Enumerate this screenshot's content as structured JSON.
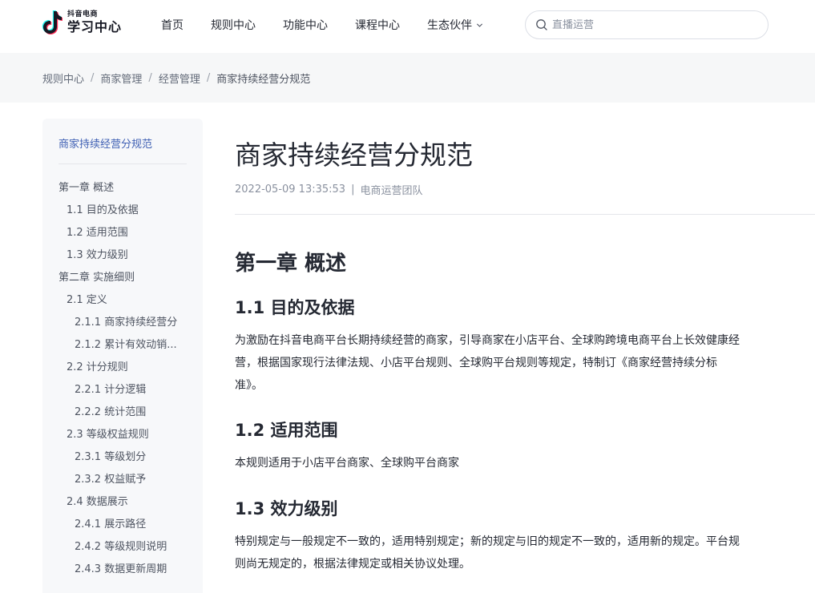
{
  "header": {
    "logo": {
      "sub": "抖音电商",
      "main": "学习中心"
    },
    "nav": [
      {
        "label": "首页"
      },
      {
        "label": "规则中心"
      },
      {
        "label": "功能中心"
      },
      {
        "label": "课程中心"
      },
      {
        "label": "生态伙伴",
        "icon": "chevron-down-icon"
      }
    ],
    "search": {
      "placeholder": "直播运营",
      "value": ""
    }
  },
  "breadcrumb": [
    "规则中心",
    "商家管理",
    "经营管理",
    "商家持续经营分规范"
  ],
  "sidebar": {
    "title": "商家持续经营分规范",
    "items": [
      {
        "label": "第一章 概述",
        "level": 1
      },
      {
        "label": "1.1 目的及依据",
        "level": 2
      },
      {
        "label": "1.2 适用范围",
        "level": 2
      },
      {
        "label": "1.3 效力级别",
        "level": 2
      },
      {
        "label": "第二章 实施细则",
        "level": 1
      },
      {
        "label": "2.1 定义",
        "level": 2
      },
      {
        "label": "2.1.1 商家持续经营分",
        "level": 3
      },
      {
        "label": "2.1.2 累计有效动销...",
        "level": 3
      },
      {
        "label": "2.2 计分规则",
        "level": 2
      },
      {
        "label": "2.2.1 计分逻辑",
        "level": 3
      },
      {
        "label": "2.2.2 统计范围",
        "level": 3
      },
      {
        "label": "2.3 等级权益规则",
        "level": 2
      },
      {
        "label": "2.3.1 等级划分",
        "level": 3
      },
      {
        "label": "2.3.2 权益赋予",
        "level": 3
      },
      {
        "label": "2.4 数据展示",
        "level": 2
      },
      {
        "label": "2.4.1 展示路径",
        "level": 3
      },
      {
        "label": "2.4.2 等级规则说明",
        "level": 3
      },
      {
        "label": "2.4.3 数据更新周期",
        "level": 3
      }
    ]
  },
  "article": {
    "title": "商家持续经营分规范",
    "date": "2022-05-09 13:35:53",
    "separator": "|",
    "author": "电商运营团队",
    "chapter1": "第一章 概述",
    "s11": {
      "heading": "1.1 目的及依据",
      "lines": [
        "为激励在抖音电商平台长期持续经营的商家，引导商家在小店平台、全球购跨境电商平台上长效健康经",
        "营，根据国家现行法律法规、小店平台规则、全球购平台规则等规定，特制订《商家经营持续分标",
        "准》。"
      ]
    },
    "s12": {
      "heading": "1.2 适用范围",
      "lines": [
        "本规则适用于小店平台商家、全球购平台商家"
      ]
    },
    "s13": {
      "heading": "1.3 效力级别",
      "lines": [
        "特别规定与一般规定不一致的，适用特别规定；新的规定与旧的规定不一致的，适用新的规定。平台规",
        "则尚无规定的，根据法律规定或相关协议处理。"
      ]
    }
  },
  "colors": {
    "accent": "#3e5fb3",
    "text": "#252933",
    "muted": "#8a919f",
    "band": "#f6f7f8",
    "sidebar_bg": "#f7f8fa"
  }
}
